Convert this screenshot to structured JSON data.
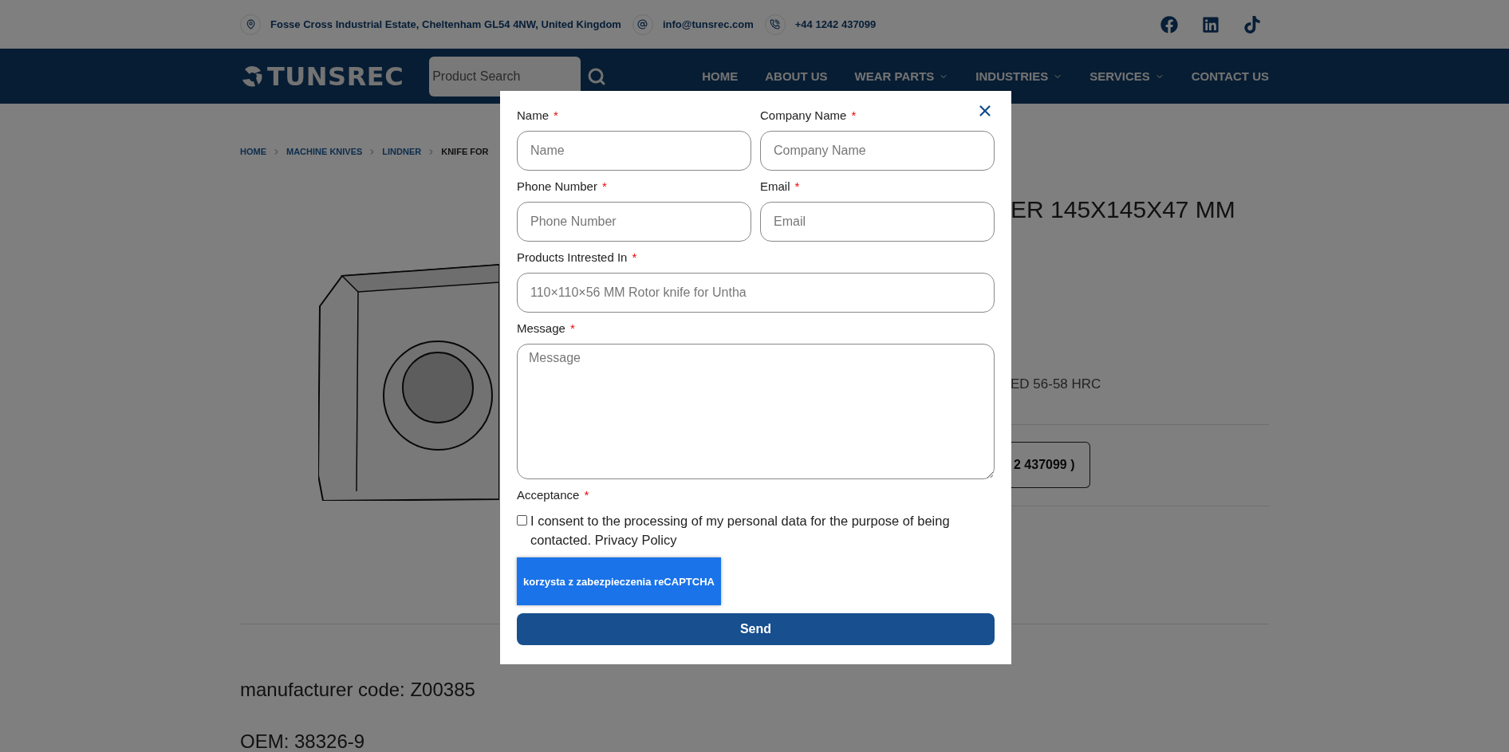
{
  "top_bar": {
    "address": "Fosse Cross Industrial Estate, Cheltenham GL54 4NW, United Kingdom",
    "email": "info@tunsrec.com",
    "phone": "+44 1242 437099"
  },
  "nav": {
    "logo": "TUNSREC",
    "search": {
      "placeholder": "Product Search"
    },
    "items": [
      {
        "label": "HOME",
        "has_dropdown": false
      },
      {
        "label": "ABOUT US",
        "has_dropdown": false
      },
      {
        "label": "WEAR PARTS",
        "has_dropdown": true
      },
      {
        "label": "INDUSTRIES",
        "has_dropdown": true
      },
      {
        "label": "SERVICES",
        "has_dropdown": true
      },
      {
        "label": "CONTACT US",
        "has_dropdown": false
      }
    ]
  },
  "breadcrumb": [
    {
      "label": "HOME",
      "kind": "link"
    },
    {
      "label": "MACHINE KNIVES",
      "kind": "link"
    },
    {
      "label": "LINDNER",
      "kind": "link"
    },
    {
      "label": "KNIFE FOR",
      "kind": "current"
    }
  ],
  "product": {
    "title": "ER 145X145X47 MM",
    "spec": "ED 56-58 HRC",
    "call_button": "2 437099 )",
    "manufacturer_code": "manufacturer code: Z00385",
    "oem": "OEM: 38326-9"
  },
  "modal": {
    "required_mark": "*",
    "rows": [
      [
        {
          "label": "Name",
          "required": true,
          "kind": "input",
          "placeholder": "Name"
        },
        {
          "label": "Company Name",
          "required": true,
          "kind": "input",
          "placeholder": "Company Name"
        }
      ],
      [
        {
          "label": "Phone Number",
          "required": true,
          "kind": "input",
          "placeholder": "Phone Number"
        },
        {
          "label": "Email",
          "required": true,
          "kind": "input",
          "placeholder": "Email"
        }
      ],
      [
        {
          "label": "Products Intrested In",
          "required": true,
          "kind": "input",
          "placeholder": "110×110×56 MM Rotor knife for Untha"
        }
      ],
      [
        {
          "label": "Message",
          "required": true,
          "kind": "textarea",
          "placeholder": "Message"
        }
      ]
    ],
    "acceptance": {
      "label": "Acceptance",
      "required": true,
      "checked": false,
      "consent": "I consent to the processing of my personal data for the purpose of being contacted. Privacy Policy"
    },
    "recaptcha": "korzysta z zabezpieczenia reCAPTCHA",
    "send": "Send"
  }
}
